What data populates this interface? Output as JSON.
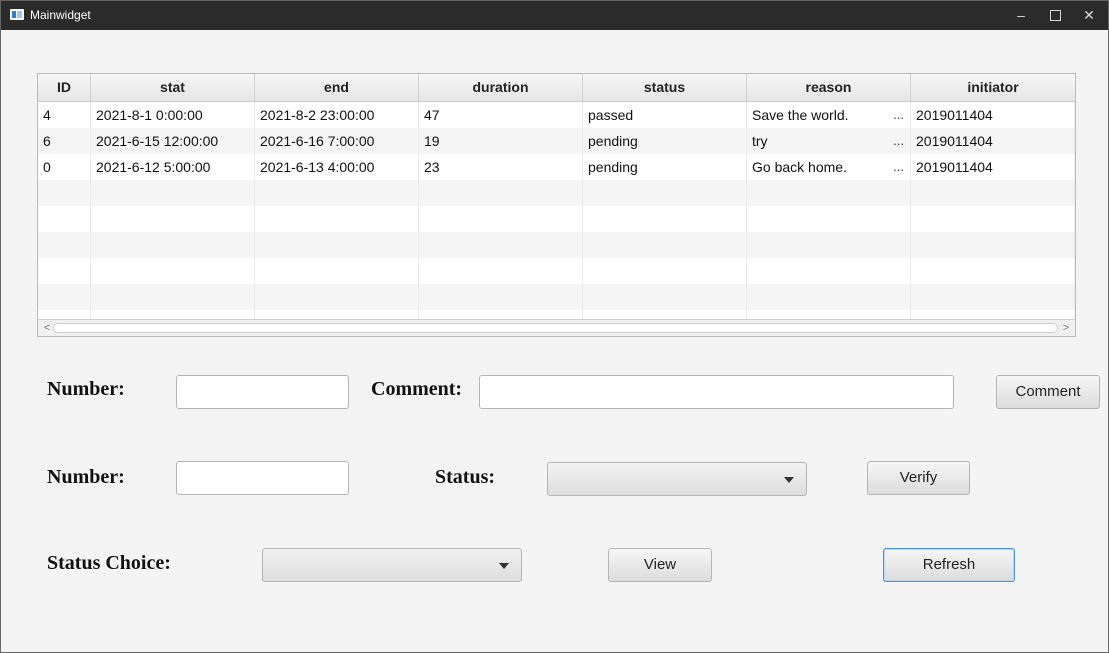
{
  "window": {
    "title": "Mainwidget",
    "controls": {
      "minimize": "–",
      "close": "✕"
    }
  },
  "table": {
    "columns": [
      "ID",
      "stat",
      "end",
      "duration",
      "status",
      "reason",
      "initiator"
    ],
    "rows": [
      {
        "id": "4",
        "stat": "2021-8-1 0:00:00",
        "end": "2021-8-2 23:00:00",
        "duration": "47",
        "status": "passed",
        "reason": "Save the world.",
        "reason_ellipsis": "...",
        "initiator": "2019011404"
      },
      {
        "id": "6",
        "stat": "2021-6-15 12:00:00",
        "end": "2021-6-16 7:00:00",
        "duration": "19",
        "status": "pending",
        "reason": "try",
        "reason_ellipsis": "...",
        "initiator": "2019011404"
      },
      {
        "id": "0",
        "stat": "2021-6-12 5:00:00",
        "end": "2021-6-13 4:00:00",
        "duration": "23",
        "status": "pending",
        "reason": "Go back home.",
        "reason_ellipsis": "...",
        "initiator": "2019011404"
      }
    ],
    "scroll_left": "<",
    "scroll_right": ">"
  },
  "form": {
    "comment_row": {
      "number_label": "Number:",
      "number_value": "",
      "comment_label": "Comment:",
      "comment_value": "",
      "button": "Comment"
    },
    "verify_row": {
      "number_label": "Number:",
      "number_value": "",
      "status_label": "Status:",
      "status_selected": "",
      "button": "Verify"
    },
    "view_row": {
      "status_choice_label": "Status Choice:",
      "status_choice_selected": "",
      "view_button": "View",
      "refresh_button": "Refresh"
    }
  }
}
